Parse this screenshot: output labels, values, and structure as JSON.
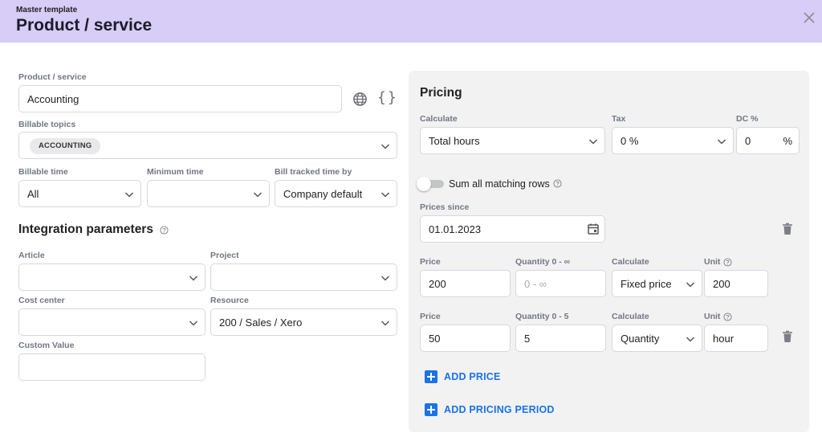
{
  "header": {
    "subtitle": "Master template",
    "title": "Product / service",
    "close_icon": "close-icon"
  },
  "left": {
    "product_service": {
      "label": "Product / service",
      "value": "Accounting"
    },
    "billable_topics": {
      "label": "Billable topics",
      "chip": "ACCOUNTING"
    },
    "billable_time": {
      "label": "Billable time",
      "value": "All"
    },
    "minimum_time": {
      "label": "Minimum time",
      "value": ""
    },
    "bill_tracked_by": {
      "label": "Bill tracked time by",
      "value": "Company default"
    },
    "integration_title": "Integration parameters",
    "article": {
      "label": "Article",
      "value": ""
    },
    "project": {
      "label": "Project",
      "value": ""
    },
    "cost_center": {
      "label": "Cost center",
      "value": ""
    },
    "resource": {
      "label": "Resource",
      "value": "200 / Sales / Xero"
    },
    "custom_value": {
      "label": "Custom Value",
      "value": ""
    }
  },
  "pricing": {
    "title": "Pricing",
    "calculate": {
      "label": "Calculate",
      "value": "Total hours"
    },
    "tax": {
      "label": "Tax",
      "value": "0 %"
    },
    "dc": {
      "label": "DC %",
      "value": "0",
      "suffix": "%"
    },
    "sum_matching_rows": {
      "label": "Sum all matching rows",
      "enabled": false
    },
    "prices_since": {
      "label": "Prices since",
      "value": "01.01.2023"
    },
    "rows": [
      {
        "price_label": "Price",
        "price": "200",
        "quantity_label": "Quantity 0 - ∞",
        "quantity": "",
        "quantity_placeholder": "0 - ∞",
        "calc_label": "Calculate",
        "calc": "Fixed price",
        "unit_label": "Unit",
        "unit": "200"
      },
      {
        "price_label": "Price",
        "price": "50",
        "quantity_label": "Quantity 0 - 5",
        "quantity": "5",
        "quantity_placeholder": "",
        "calc_label": "Calculate",
        "calc": "Quantity",
        "unit_label": "Unit",
        "unit": "hour"
      }
    ],
    "add_price": "ADD PRICE",
    "add_pricing_period": "ADD PRICING PERIOD"
  },
  "colors": {
    "header_bg": "#d7cdf6",
    "panel_bg": "#f2f2f3",
    "accent": "#1a73e8"
  }
}
